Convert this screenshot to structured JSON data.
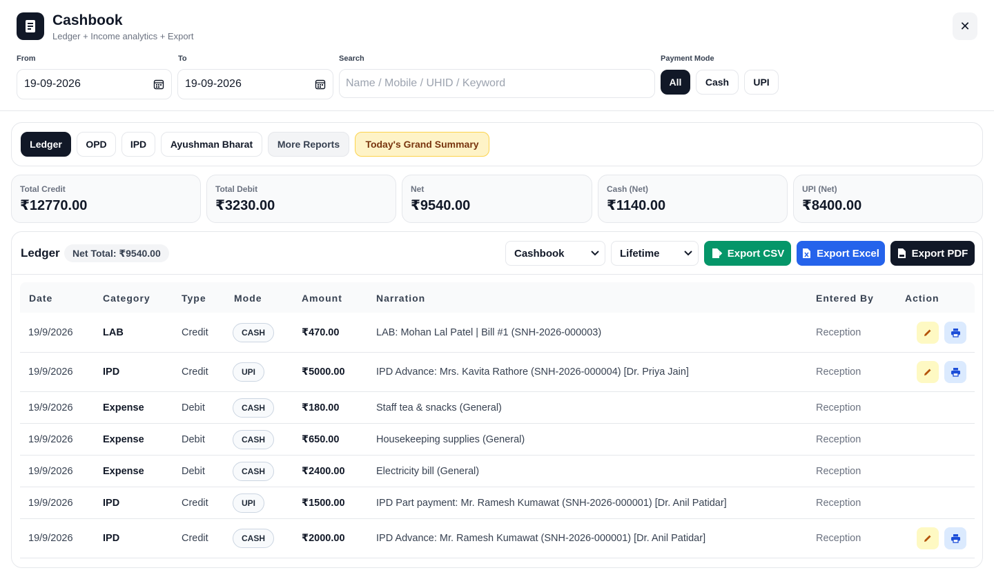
{
  "app": {
    "title": "Cashbook",
    "subtitle": "Ledger + Income analytics + Export",
    "close_glyph": "✕"
  },
  "filters": {
    "from_label": "From",
    "from_value": "19-09-2026",
    "to_label": "To",
    "to_value": "19-09-2026",
    "search_label": "Search",
    "search_placeholder": "Name / Mobile / UHID / Keyword",
    "search_value": "",
    "payment_mode_label": "Payment Mode",
    "payment_modes": [
      "All",
      "Cash",
      "UPI"
    ],
    "payment_mode_selected": "All"
  },
  "tabs": [
    "Ledger",
    "OPD",
    "IPD",
    "Ayushman Bharat",
    "More Reports",
    "Today's Grand Summary"
  ],
  "tab_selected": "Ledger",
  "stats": [
    {
      "label": "Total Credit",
      "value": "₹12770.00"
    },
    {
      "label": "Total Debit",
      "value": "₹3230.00"
    },
    {
      "label": "Net",
      "value": "₹9540.00"
    },
    {
      "label": "Cash (Net)",
      "value": "₹1140.00"
    },
    {
      "label": "UPI (Net)",
      "value": "₹8400.00"
    }
  ],
  "ledger": {
    "title": "Ledger",
    "net_total": "Net Total: ₹9540.00",
    "book_select": "Cashbook",
    "period_select": "Lifetime",
    "export_csv": "Export CSV",
    "export_excel": "Export Excel",
    "export_pdf": "Export PDF",
    "columns": [
      "Date",
      "Category",
      "Type",
      "Mode",
      "Amount",
      "Narration",
      "Entered By",
      "Action"
    ],
    "rows": [
      {
        "date": "19/9/2026",
        "category": "LAB",
        "type": "Credit",
        "mode": "CASH",
        "amount": "₹470.00",
        "narration": "LAB: Mohan Lal Patel | Bill #1 (SNH-2026-000003)",
        "entered_by": "Reception",
        "actions": true
      },
      {
        "date": "19/9/2026",
        "category": "IPD",
        "type": "Credit",
        "mode": "UPI",
        "amount": "₹5000.00",
        "narration": "IPD Advance: Mrs. Kavita Rathore (SNH-2026-000004) [Dr. Priya Jain]",
        "entered_by": "Reception",
        "actions": true
      },
      {
        "date": "19/9/2026",
        "category": "Expense",
        "type": "Debit",
        "mode": "CASH",
        "amount": "₹180.00",
        "narration": "Staff tea & snacks (General)",
        "entered_by": "Reception",
        "actions": false
      },
      {
        "date": "19/9/2026",
        "category": "Expense",
        "type": "Debit",
        "mode": "CASH",
        "amount": "₹650.00",
        "narration": "Housekeeping supplies (General)",
        "entered_by": "Reception",
        "actions": false
      },
      {
        "date": "19/9/2026",
        "category": "Expense",
        "type": "Debit",
        "mode": "CASH",
        "amount": "₹2400.00",
        "narration": "Electricity bill (General)",
        "entered_by": "Reception",
        "actions": false
      },
      {
        "date": "19/9/2026",
        "category": "IPD",
        "type": "Credit",
        "mode": "UPI",
        "amount": "₹1500.00",
        "narration": "IPD Part payment: Mr. Ramesh Kumawat (SNH-2026-000001) [Dr. Anil Patidar]",
        "entered_by": "Reception",
        "actions": false
      },
      {
        "date": "19/9/2026",
        "category": "IPD",
        "type": "Credit",
        "mode": "CASH",
        "amount": "₹2000.00",
        "narration": "IPD Advance: Mr. Ramesh Kumawat (SNH-2026-000001) [Dr. Anil Patidar]",
        "entered_by": "Reception",
        "actions": true
      }
    ]
  },
  "colors": {
    "dark": "#111827",
    "csv_green": "#059669",
    "excel_blue": "#2563eb",
    "summary_yellow": "#fef3c7"
  },
  "icons": {
    "logo": "book-icon",
    "calendar": "calendar-icon",
    "close": "close-icon",
    "chevron": "chevron-down-icon",
    "csv": "file-export-icon",
    "excel": "excel-file-icon",
    "pdf": "pdf-file-icon",
    "edit": "pencil-icon",
    "print": "printer-icon"
  }
}
